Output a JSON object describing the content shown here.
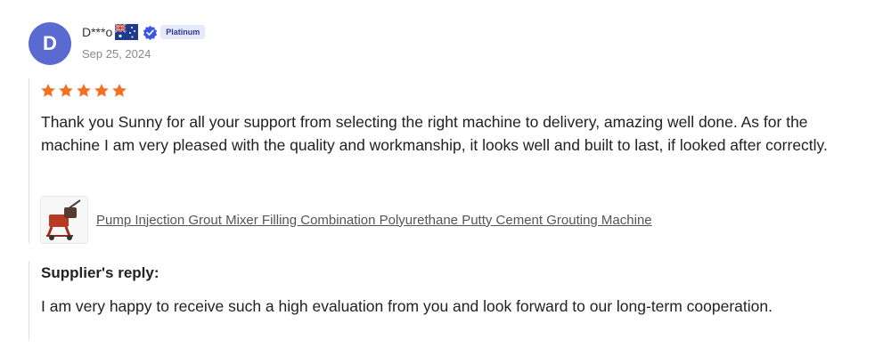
{
  "reviewer": {
    "initial": "D",
    "name": "D***o",
    "badge": "Platinum",
    "date": "Sep 25, 2024"
  },
  "rating": {
    "value": 5,
    "max": 5,
    "star_color": "#f36f21"
  },
  "review": {
    "text": "Thank you Sunny for all your support from selecting the right machine to delivery, amazing well done. As for the machine I am very pleased with the quality and workmanship, it looks well and built to last, if looked after correctly."
  },
  "product": {
    "link_text": "Pump Injection Grout Mixer Filling Combination Polyurethane Putty Cement Grouting Machine",
    "thumbnail_icon": "grout-machine-thumbnail"
  },
  "supplier_reply": {
    "title": "Supplier's reply:",
    "text": "I am very happy to receive such a high evaluation from you and look forward to our long-term cooperation."
  },
  "colors": {
    "avatar": "#5a6ad0",
    "badge_bg": "#e6e9fa",
    "badge_text": "#2a3a8c",
    "verified": "#3b55e6"
  }
}
